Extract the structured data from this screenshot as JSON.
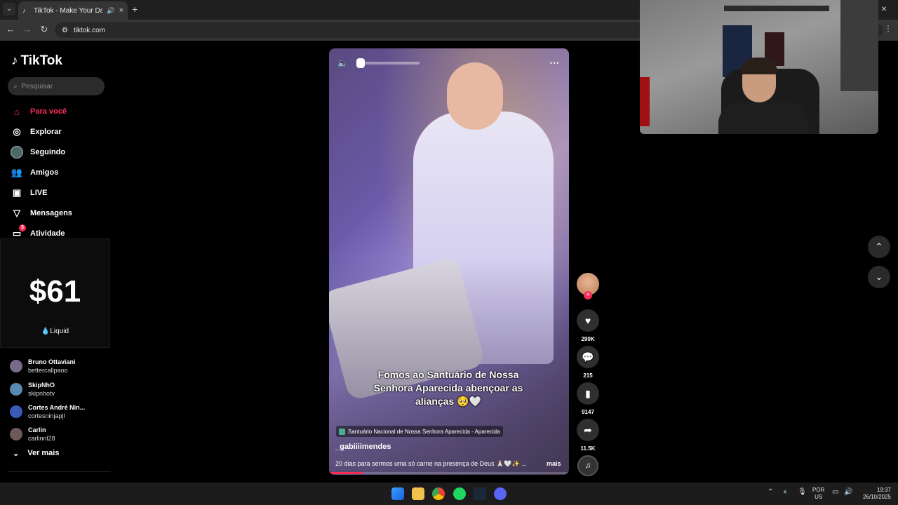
{
  "browser": {
    "tab_title": "TikTok - Make Your Day",
    "url": "tiktok.com"
  },
  "sidebar": {
    "logo": "TikTok",
    "search_placeholder": "Pesquisar",
    "nav": [
      {
        "label": "Para você",
        "icon": "home-icon"
      },
      {
        "label": "Explorar",
        "icon": "compass-icon"
      },
      {
        "label": "Seguindo",
        "icon": "following-avatar-icon"
      },
      {
        "label": "Amigos",
        "icon": "friends-icon"
      },
      {
        "label": "LIVE",
        "icon": "live-icon"
      },
      {
        "label": "Mensagens",
        "icon": "send-icon"
      },
      {
        "label": "Atividade",
        "icon": "activity-icon",
        "badge": "3"
      }
    ],
    "ad": {
      "price": "$61",
      "brand": "Liquid"
    },
    "following": [
      {
        "name": "Bruno Ottaviani",
        "handle": "bettercallpaoo"
      },
      {
        "name": "SkipNhO",
        "handle": "skipnhotv"
      },
      {
        "name": "Cortes André Nin...",
        "handle": "cortesninjapjl"
      },
      {
        "name": "Carlin",
        "handle": "carlinnl28"
      }
    ],
    "see_more": "Ver mais"
  },
  "video": {
    "caption": "Fomos ao Santuário de Nossa Senhora Aparecida abençoar as alianças 🥺🤍",
    "location": "Santuário Nacional de Nossa Senhora Aparecida - Aparecida",
    "author": "_gabiiiimendes",
    "description": "20 dias para sermos uma só carne na presença de Deus 🙏🏻🤍✨ ...",
    "more": "mais",
    "progress": 0.14
  },
  "actions": {
    "likes": "290K",
    "comments": "215",
    "saves": "9147",
    "shares": "11.5K"
  },
  "taskbar": {
    "lang_top": "POR",
    "lang_bottom": "US",
    "time": "19:37",
    "date": "26/10/2025"
  }
}
